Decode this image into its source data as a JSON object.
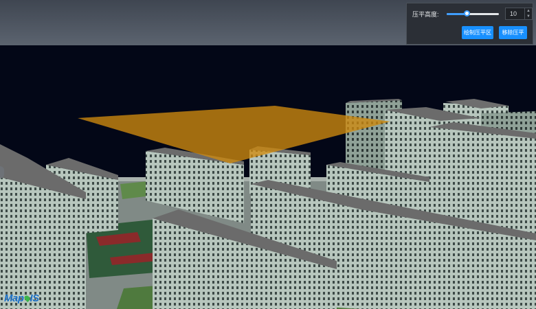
{
  "panel": {
    "height_label": "压平高度:",
    "height_value": "10",
    "slider_fraction": 0.4,
    "draw_button": "绘制压平区",
    "remove_button": "移除压平"
  },
  "logo": {
    "text_before": "Map",
    "text_after": "IS"
  },
  "icons": {
    "increment": "chevron-up-icon",
    "decrement": "chevron-down-icon"
  },
  "colors": {
    "accent": "#1890ff",
    "flatten_area": "#d08a0e",
    "sky": "#030717"
  }
}
